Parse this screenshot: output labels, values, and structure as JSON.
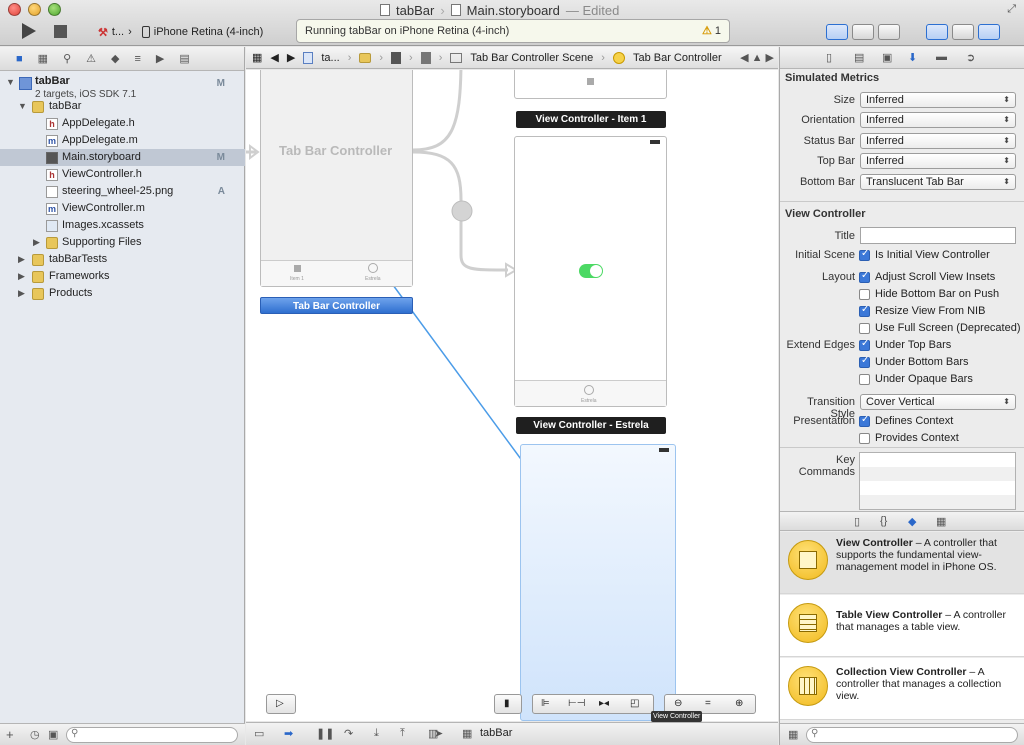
{
  "window": {
    "project": "tabBar",
    "file": "Main.storyboard",
    "state": "— Edited"
  },
  "toolbar": {
    "scheme_target": "t...",
    "device": "iPhone Retina (4-inch)",
    "activity": "Running tabBar on iPhone Retina (4-inch)",
    "warnings": "1"
  },
  "navigator": {
    "items": [
      {
        "label": "tabBar",
        "sub": "2 targets, iOS SDK 7.1",
        "badge": "M"
      },
      {
        "label": "tabBar"
      },
      {
        "label": "AppDelegate.h"
      },
      {
        "label": "AppDelegate.m"
      },
      {
        "label": "Main.storyboard",
        "badge": "M"
      },
      {
        "label": "ViewController.h"
      },
      {
        "label": "steering_wheel-25.png",
        "badge": "A"
      },
      {
        "label": "ViewController.m"
      },
      {
        "label": "Images.xcassets"
      },
      {
        "label": "Supporting Files"
      },
      {
        "label": "tabBarTests"
      },
      {
        "label": "Frameworks"
      },
      {
        "label": "Products"
      }
    ]
  },
  "jumpbar": {
    "project": "ta...",
    "scene": "Tab Bar Controller Scene",
    "object": "Tab Bar Controller"
  },
  "canvas": {
    "tab_controller_title": "Tab Bar Controller",
    "tab_controller_label": "Tab Bar Controller",
    "vc_item1_label": "View Controller - Item 1",
    "vc_estrela_label": "View Controller - Estrela",
    "tab_item_1": "Item 1",
    "tab_item_2": "Estrela",
    "tooltip": "View Controller"
  },
  "debug": {
    "process": "tabBar"
  },
  "inspector": {
    "simulated_metrics": {
      "title": "Simulated Metrics",
      "size_label": "Size",
      "size": "Inferred",
      "orientation_label": "Orientation",
      "orientation": "Inferred",
      "status_bar_label": "Status Bar",
      "status_bar": "Inferred",
      "top_bar_label": "Top Bar",
      "top_bar": "Inferred",
      "bottom_bar_label": "Bottom Bar",
      "bottom_bar": "Translucent Tab Bar"
    },
    "view_controller": {
      "title": "View Controller",
      "title_label": "Title",
      "initial_scene_label": "Initial Scene",
      "initial_scene": "Is Initial View Controller",
      "layout_label": "Layout",
      "layout_options": [
        {
          "label": "Adjust Scroll View Insets",
          "checked": true
        },
        {
          "label": "Hide Bottom Bar on Push",
          "checked": false
        },
        {
          "label": "Resize View From NIB",
          "checked": true
        },
        {
          "label": "Use Full Screen (Deprecated)",
          "checked": false
        }
      ],
      "extend_edges_label": "Extend Edges",
      "extend_edges": [
        {
          "label": "Under Top Bars",
          "checked": true
        },
        {
          "label": "Under Bottom Bars",
          "checked": true
        },
        {
          "label": "Under Opaque Bars",
          "checked": false
        }
      ],
      "transition_label": "Transition Style",
      "transition": "Cover Vertical",
      "presentation_label": "Presentation",
      "presentation": [
        {
          "label": "Defines Context",
          "checked": true
        },
        {
          "label": "Provides Context",
          "checked": false
        }
      ],
      "key_commands_label": "Key Commands"
    },
    "library": [
      {
        "name": "View Controller",
        "desc": " – A controller that supports the fundamental view-management model in iPhone OS."
      },
      {
        "name": "Table View Controller",
        "desc": " – A controller that manages a table view."
      },
      {
        "name": "Collection View Controller",
        "desc": " – A controller that manages a collection view."
      }
    ]
  }
}
